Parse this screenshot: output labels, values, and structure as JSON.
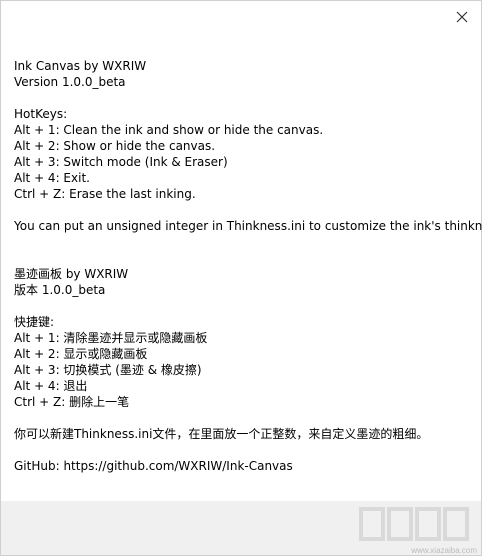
{
  "dialog": {
    "close_glyph": "✕",
    "lines_en": {
      "title": "Ink Canvas by WXRIW",
      "version": "Version 1.0.0_beta",
      "hotkeys_header": "HotKeys:",
      "hk1": "Alt + 1: Clean the ink and show or hide the canvas.",
      "hk2": "Alt + 2: Show or hide the canvas.",
      "hk3": "Alt + 3: Switch mode (Ink & Eraser)",
      "hk4": "Alt + 4: Exit.",
      "hk5": "Ctrl + Z: Erase the last inking.",
      "note": "You can put an unsigned integer in Thinkness.ini to customize the ink's thinkness."
    },
    "lines_zh": {
      "title": "墨迹画板 by WXRIW",
      "version": "版本 1.0.0_beta",
      "hotkeys_header": "快捷键:",
      "hk1": "Alt + 1: 清除墨迹并显示或隐藏画板",
      "hk2": "Alt + 2: 显示或隐藏画板",
      "hk3": "Alt + 3: 切换模式 (墨迹 & 橡皮擦)",
      "hk4": "Alt + 4: 退出",
      "hk5": "Ctrl + Z: 删除上一笔",
      "note": "你可以新建Thinkness.ini文件，在里面放一个正整数，来自定义墨迹的粗细。"
    },
    "github": "GitHub: https://github.com/WXRIW/Ink-Canvas"
  },
  "watermark": {
    "text": "www.xiazaiba.com"
  },
  "colors": {
    "content_bg": "#ffffff",
    "footer_bg": "#f0f0f0",
    "text": "#000000"
  }
}
